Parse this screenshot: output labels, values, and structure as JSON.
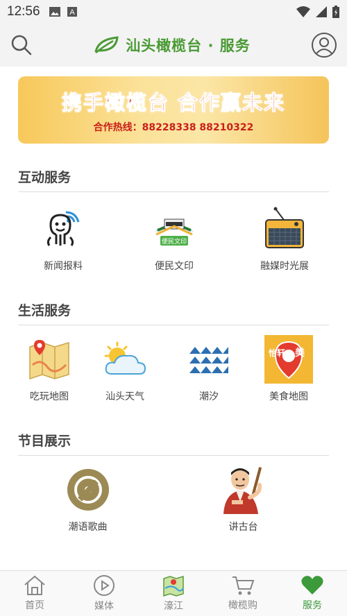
{
  "status_bar": {
    "time": "12:56"
  },
  "app_bar": {
    "title": "汕头橄榄台 · 服务",
    "brand_color": "#4a9a34"
  },
  "banner": {
    "headline": "携手橄榄台 合作赢未来",
    "hotline": "合作热线：88228338 88210322"
  },
  "sections": [
    {
      "title": "互动服务",
      "items": [
        {
          "label": "新闻报料",
          "icon": "robot-broadcast-icon"
        },
        {
          "label": "便民文印",
          "icon": "printer-icon"
        },
        {
          "label": "融媒时光展",
          "icon": "radio-icon"
        }
      ]
    },
    {
      "title": "生活服务",
      "items": [
        {
          "label": "吃玩地图",
          "icon": "map-icon"
        },
        {
          "label": "汕头天气",
          "icon": "weather-icon"
        },
        {
          "label": "潮汐",
          "icon": "waves-icon"
        },
        {
          "label": "美食地图",
          "icon": "food-map-icon"
        }
      ]
    },
    {
      "title": "节目展示",
      "items": [
        {
          "label": "潮语歌曲",
          "icon": "vinyl-icon"
        },
        {
          "label": "讲古台",
          "icon": "storyteller-icon"
        }
      ]
    }
  ],
  "bottom_nav": [
    {
      "label": "首页",
      "icon": "home-icon"
    },
    {
      "label": "媒体",
      "icon": "play-icon"
    },
    {
      "label": "濠江",
      "icon": "map-icon"
    },
    {
      "label": "橄榄购",
      "icon": "cart-icon"
    },
    {
      "label": "服务",
      "icon": "heart-icon",
      "active": true
    }
  ],
  "accent_color": "#3c9a3a"
}
